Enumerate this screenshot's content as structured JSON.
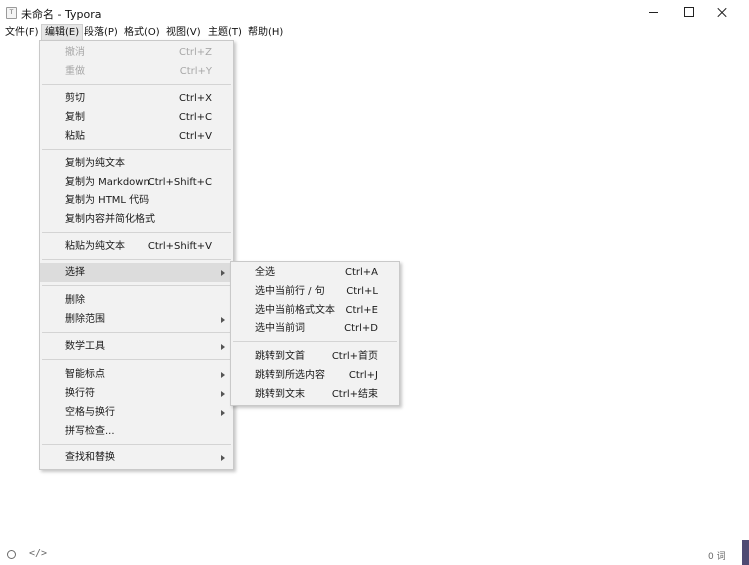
{
  "window": {
    "icon_glyph": "T",
    "title": "未命名 - Typora"
  },
  "menubar": [
    "文件(F)",
    "编辑(E)",
    "段落(P)",
    "格式(O)",
    "视图(V)",
    "主题(T)",
    "帮助(H)"
  ],
  "edit_menu": {
    "undo": {
      "label": "撤消",
      "shortcut": "Ctrl+Z"
    },
    "redo": {
      "label": "重做",
      "shortcut": "Ctrl+Y"
    },
    "cut": {
      "label": "剪切",
      "shortcut": "Ctrl+X"
    },
    "copy": {
      "label": "复制",
      "shortcut": "Ctrl+C"
    },
    "paste": {
      "label": "粘贴",
      "shortcut": "Ctrl+V"
    },
    "copy_plain": {
      "label": "复制为纯文本"
    },
    "copy_markdown": {
      "label": "复制为 Markdown",
      "shortcut": "Ctrl+Shift+C"
    },
    "copy_html": {
      "label": "复制为 HTML 代码"
    },
    "copy_simplified": {
      "label": "复制内容并简化格式"
    },
    "paste_plain": {
      "label": "粘贴为纯文本",
      "shortcut": "Ctrl+Shift+V"
    },
    "select": {
      "label": "选择"
    },
    "delete": {
      "label": "删除"
    },
    "delete_range": {
      "label": "删除范围"
    },
    "math_tools": {
      "label": "数学工具"
    },
    "smart_punct": {
      "label": "智能标点"
    },
    "line_ending": {
      "label": "换行符"
    },
    "whitespace": {
      "label": "空格与换行"
    },
    "spellcheck": {
      "label": "拼写检查..."
    },
    "find_replace": {
      "label": "查找和替换"
    }
  },
  "select_menu": {
    "select_all": {
      "label": "全选",
      "shortcut": "Ctrl+A"
    },
    "select_line": {
      "label": "选中当前行 / 句",
      "shortcut": "Ctrl+L"
    },
    "select_format": {
      "label": "选中当前格式文本",
      "shortcut": "Ctrl+E"
    },
    "select_word": {
      "label": "选中当前词",
      "shortcut": "Ctrl+D"
    },
    "jump_top": {
      "label": "跳转到文首",
      "shortcut": "Ctrl+首页"
    },
    "jump_selection": {
      "label": "跳转到所选内容",
      "shortcut": "Ctrl+J"
    },
    "jump_end": {
      "label": "跳转到文末",
      "shortcut": "Ctrl+结束"
    }
  },
  "statusbar": {
    "code_glyph": "</>",
    "word_count": "0 词"
  }
}
